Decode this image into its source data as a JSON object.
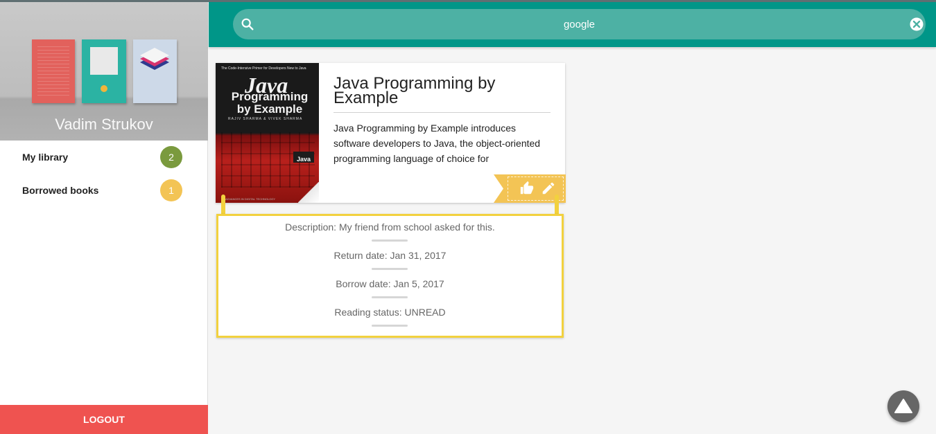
{
  "search": {
    "value": "google"
  },
  "sidebar": {
    "user_name": "Vadim Strukov",
    "items": [
      {
        "label": "My library",
        "count": "2",
        "badge_color": "#7a9a3e"
      },
      {
        "label": "Borrowed books",
        "count": "1",
        "badge_color": "#f3c455"
      }
    ],
    "logout_label": "LOGOUT"
  },
  "book": {
    "title": "Java Programming by Example",
    "description": "Java Programming by Example introduces software developers to Java, the object-oriented programming language of choice for",
    "cover": {
      "tagline": "The Code-Intensive Primer for Developers New to Java",
      "java_text": "Java",
      "subtitle": "Programming by Example",
      "authors": "RAJIV SHARMA & VIVEK SHARMA",
      "badge": "Java",
      "footer": "ADVANCES IN DIGITAL TECHNOLOGY"
    },
    "actions": {
      "like_icon": "thumb-up-icon",
      "edit_icon": "pencil-icon"
    }
  },
  "details": {
    "description": "Description: My friend from school asked for this.",
    "return_date": "Return date: Jan 31, 2017",
    "borrow_date": "Borrow date: Jan 5, 2017",
    "reading_status": "Reading status: UNREAD"
  },
  "colors": {
    "topbar": "#009688",
    "search_bg": "#4db1a4",
    "logout": "#ef5350",
    "ribbon": "#f3c455",
    "panel_border": "#f2d13e"
  }
}
